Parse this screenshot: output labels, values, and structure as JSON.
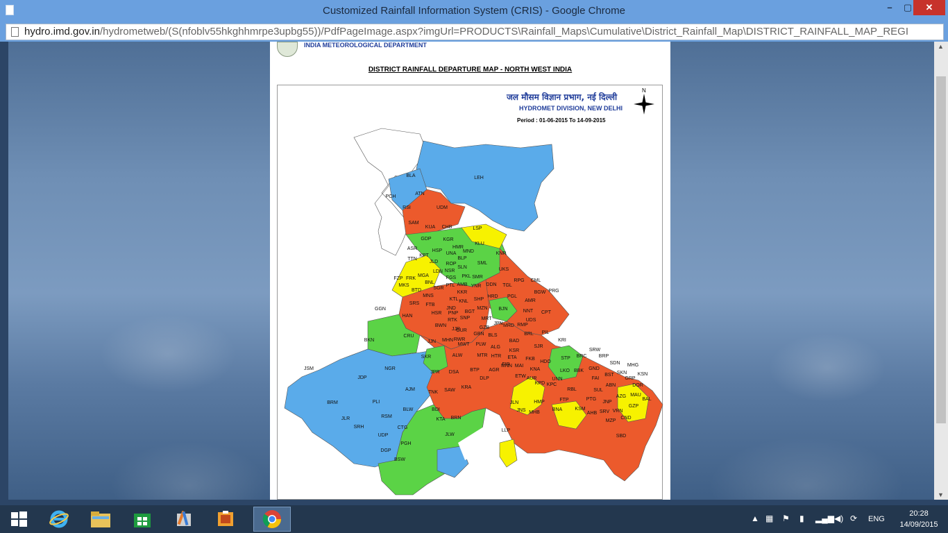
{
  "window": {
    "title": "Customized Rainfall Information System (CRIS) - Google Chrome",
    "min_glyph": "–",
    "max_glyph": "▢",
    "close_glyph": "✕"
  },
  "addressbar": {
    "host": "hydro.imd.gov.in",
    "path": "/hydrometweb/(S(nfoblv55hkghhmrpe3upbg55))/PdfPageImage.aspx?imgUrl=PRODUCTS\\Rainfall_Maps\\Cumulative\\District_Rainfall_Map\\DISTRICT_RAINFALL_MAP_REGI"
  },
  "document": {
    "org_name": "INDIA METEOROLOGICAL DEPARTMENT",
    "map_title": "DISTRICT RAINFALL DEPARTURE MAP - NORTH WEST INDIA",
    "hindi_title": "जल मौसम विज्ञान प्रभाग, नई दिल्ली",
    "division": "HYDROMET DIVISION, NEW DELHI",
    "period": "Period : 01-06-2015 To 14-09-2015",
    "north_label": "N"
  },
  "colors": {
    "red": "#ec5a2c",
    "green": "#5bd346",
    "yellow": "#f7f200",
    "blue": "#5aabea",
    "white": "#ffffff"
  },
  "districts": [
    {
      "label": "LEH",
      "color": "blue"
    },
    {
      "label": "BLA",
      "color": "blue"
    },
    {
      "label": "ATN",
      "color": "blue"
    },
    {
      "label": "PCH",
      "color": "white"
    },
    {
      "label": "RSI",
      "color": "red"
    },
    {
      "label": "UDM",
      "color": "red"
    },
    {
      "label": "SAM",
      "color": "red"
    },
    {
      "label": "KUA",
      "color": "green"
    },
    {
      "label": "CHB",
      "color": "green"
    },
    {
      "label": "LSP",
      "color": "yellow"
    },
    {
      "label": "GDP",
      "color": "green"
    },
    {
      "label": "KGR",
      "color": "green"
    },
    {
      "label": "HMR",
      "color": "green"
    },
    {
      "label": "MND",
      "color": "green"
    },
    {
      "label": "KLU",
      "color": "green"
    },
    {
      "label": "ASR",
      "color": "red"
    },
    {
      "label": "HSP",
      "color": "red"
    },
    {
      "label": "UNA",
      "color": "blue"
    },
    {
      "label": "BLP",
      "color": "green"
    },
    {
      "label": "KNR",
      "color": "red"
    },
    {
      "label": "TTN",
      "color": "yellow"
    },
    {
      "label": "KPT",
      "color": "yellow"
    },
    {
      "label": "JLD",
      "color": "yellow"
    },
    {
      "label": "ROP",
      "color": "red"
    },
    {
      "label": "SLN",
      "color": "green"
    },
    {
      "label": "SML",
      "color": "green"
    },
    {
      "label": "LDN",
      "color": "red"
    },
    {
      "label": "NSR",
      "color": "red"
    },
    {
      "label": "UKS",
      "color": "red"
    },
    {
      "label": "FZP",
      "color": "yellow"
    },
    {
      "label": "FRK",
      "color": "red"
    },
    {
      "label": "MGA",
      "color": "red"
    },
    {
      "label": "FGS",
      "color": "red"
    },
    {
      "label": "PKL",
      "color": "red"
    },
    {
      "label": "SMR",
      "color": "red"
    },
    {
      "label": "BNL",
      "color": "red"
    },
    {
      "label": "RPG",
      "color": "red"
    },
    {
      "label": "CML",
      "color": "green"
    },
    {
      "label": "MKS",
      "color": "red"
    },
    {
      "label": "BTD",
      "color": "red"
    },
    {
      "label": "SGR",
      "color": "red"
    },
    {
      "label": "PTL",
      "color": "red"
    },
    {
      "label": "AMB",
      "color": "red"
    },
    {
      "label": "YNR",
      "color": "red"
    },
    {
      "label": "DDN",
      "color": "red"
    },
    {
      "label": "TGL",
      "color": "red"
    },
    {
      "label": "PRG",
      "color": "red"
    },
    {
      "label": "MNS",
      "color": "yellow"
    },
    {
      "label": "KKR",
      "color": "red"
    },
    {
      "label": "HRD",
      "color": "red"
    },
    {
      "label": "PGL",
      "color": "red"
    },
    {
      "label": "BGW",
      "color": "green"
    },
    {
      "label": "KTL",
      "color": "red"
    },
    {
      "label": "KNL",
      "color": "red"
    },
    {
      "label": "SHP",
      "color": "red"
    },
    {
      "label": "AMR",
      "color": "red"
    },
    {
      "label": "GGN",
      "color": "green"
    },
    {
      "label": "SRS",
      "color": "red"
    },
    {
      "label": "FTB",
      "color": "yellow"
    },
    {
      "label": "JND",
      "color": "red"
    },
    {
      "label": "MZN",
      "color": "red"
    },
    {
      "label": "BJN",
      "color": "green"
    },
    {
      "label": "NNT",
      "color": "green"
    },
    {
      "label": "CPT",
      "color": "green"
    },
    {
      "label": "HSR",
      "color": "red"
    },
    {
      "label": "PNP",
      "color": "red"
    },
    {
      "label": "BGT",
      "color": "red"
    },
    {
      "label": "HAN",
      "color": "green"
    },
    {
      "label": "SNP",
      "color": "red"
    },
    {
      "label": "MRT",
      "color": "red"
    },
    {
      "label": "UDS",
      "color": "yellow"
    },
    {
      "label": "RTK",
      "color": "red"
    },
    {
      "label": "BWN",
      "color": "red"
    },
    {
      "label": "JPN",
      "color": "red"
    },
    {
      "label": "MRD",
      "color": "red"
    },
    {
      "label": "RMP",
      "color": "red"
    },
    {
      "label": "GZB",
      "color": "red"
    },
    {
      "label": "JJR",
      "color": "red"
    },
    {
      "label": "GUR",
      "color": "red"
    },
    {
      "label": "GBN",
      "color": "green"
    },
    {
      "label": "PIL",
      "color": "yellow"
    },
    {
      "label": "BRL",
      "color": "red"
    },
    {
      "label": "RWR",
      "color": "red"
    },
    {
      "label": "BLS",
      "color": "red"
    },
    {
      "label": "CRU",
      "color": "blue"
    },
    {
      "label": "MHN",
      "color": "red"
    },
    {
      "label": "MWT",
      "color": "red"
    },
    {
      "label": "PLW",
      "color": "red"
    },
    {
      "label": "KRI",
      "color": "green"
    },
    {
      "label": "BKN",
      "color": "blue"
    },
    {
      "label": "JJN",
      "color": "green"
    },
    {
      "label": "ALG",
      "color": "red"
    },
    {
      "label": "BAD",
      "color": "red"
    },
    {
      "label": "SJR",
      "color": "red"
    },
    {
      "label": "SKR",
      "color": "blue"
    },
    {
      "label": "ALW",
      "color": "red"
    },
    {
      "label": "MTR",
      "color": "red"
    },
    {
      "label": "HTR",
      "color": "red"
    },
    {
      "label": "KSR",
      "color": "red"
    },
    {
      "label": "ETA",
      "color": "red"
    },
    {
      "label": "FKB",
      "color": "red"
    },
    {
      "label": "HDO",
      "color": "red"
    },
    {
      "label": "STP",
      "color": "red"
    },
    {
      "label": "BRC",
      "color": "red"
    },
    {
      "label": "SRW",
      "color": "red"
    },
    {
      "label": "BRP",
      "color": "red"
    },
    {
      "label": "MNN",
      "color": "red"
    },
    {
      "label": "FIR",
      "color": "red"
    },
    {
      "label": "MAI",
      "color": "yellow"
    },
    {
      "label": "KNA",
      "color": "red"
    },
    {
      "label": "UNN",
      "color": "red"
    },
    {
      "label": "LKO",
      "color": "red"
    },
    {
      "label": "BBK",
      "color": "red"
    },
    {
      "label": "GND",
      "color": "red"
    },
    {
      "label": "SDN",
      "color": "red"
    },
    {
      "label": "MHG",
      "color": "yellow"
    },
    {
      "label": "KSN",
      "color": "yellow"
    },
    {
      "label": "JSM",
      "color": "blue"
    },
    {
      "label": "NGR",
      "color": "blue"
    },
    {
      "label": "JDP",
      "color": "blue"
    },
    {
      "label": "JPR",
      "color": "red"
    },
    {
      "label": "DSA",
      "color": "red"
    },
    {
      "label": "BTP",
      "color": "red"
    },
    {
      "label": "AGR",
      "color": "yellow"
    },
    {
      "label": "DLP",
      "color": "red"
    },
    {
      "label": "ETW",
      "color": "red"
    },
    {
      "label": "AUR",
      "color": "yellow"
    },
    {
      "label": "KPD",
      "color": "yellow"
    },
    {
      "label": "KPC",
      "color": "yellow"
    },
    {
      "label": "RBL",
      "color": "yellow"
    },
    {
      "label": "FAI",
      "color": "red"
    },
    {
      "label": "BST",
      "color": "red"
    },
    {
      "label": "SKN",
      "color": "red"
    },
    {
      "label": "GRP",
      "color": "red"
    },
    {
      "label": "DOR",
      "color": "red"
    },
    {
      "label": "AJM",
      "color": "green"
    },
    {
      "label": "TNK",
      "color": "green"
    },
    {
      "label": "SAW",
      "color": "red"
    },
    {
      "label": "KRA",
      "color": "red"
    },
    {
      "label": "ABN",
      "color": "yellow"
    },
    {
      "label": "SUL",
      "color": "red"
    },
    {
      "label": "AZG",
      "color": "red"
    },
    {
      "label": "MAU",
      "color": "yellow"
    },
    {
      "label": "BAL",
      "color": "red"
    },
    {
      "label": "BRM",
      "color": "blue"
    },
    {
      "label": "PLI",
      "color": "blue"
    },
    {
      "label": "BLW",
      "color": "green"
    },
    {
      "label": "BDI",
      "color": "green"
    },
    {
      "label": "JLN",
      "color": "red"
    },
    {
      "label": "HMP",
      "color": "red"
    },
    {
      "label": "FTP",
      "color": "yellow"
    },
    {
      "label": "PTG",
      "color": "red"
    },
    {
      "label": "JNP",
      "color": "red"
    },
    {
      "label": "GZP",
      "color": "red"
    },
    {
      "label": "JLR",
      "color": "blue"
    },
    {
      "label": "RSM",
      "color": "green"
    },
    {
      "label": "KTA",
      "color": "green"
    },
    {
      "label": "BRN",
      "color": "green"
    },
    {
      "label": "JNS",
      "color": "red"
    },
    {
      "label": "MHB",
      "color": "yellow"
    },
    {
      "label": "BNA",
      "color": "red"
    },
    {
      "label": "KSM",
      "color": "yellow"
    },
    {
      "label": "AHB",
      "color": "red"
    },
    {
      "label": "SRV",
      "color": "red"
    },
    {
      "label": "VRN",
      "color": "green"
    },
    {
      "label": "CND",
      "color": "red"
    },
    {
      "label": "MZP",
      "color": "red"
    },
    {
      "label": "SRH",
      "color": "blue"
    },
    {
      "label": "UDP",
      "color": "green"
    },
    {
      "label": "CTG",
      "color": "green"
    },
    {
      "label": "JLW",
      "color": "blue"
    },
    {
      "label": "LLP",
      "color": "yellow"
    },
    {
      "label": "SBD",
      "color": "red"
    },
    {
      "label": "DGP",
      "color": "green"
    },
    {
      "label": "PGH",
      "color": "green"
    },
    {
      "label": "BSW",
      "color": "green"
    }
  ],
  "taskbar": {
    "lang": "ENG",
    "time": "20:28",
    "date": "14/09/2015"
  }
}
